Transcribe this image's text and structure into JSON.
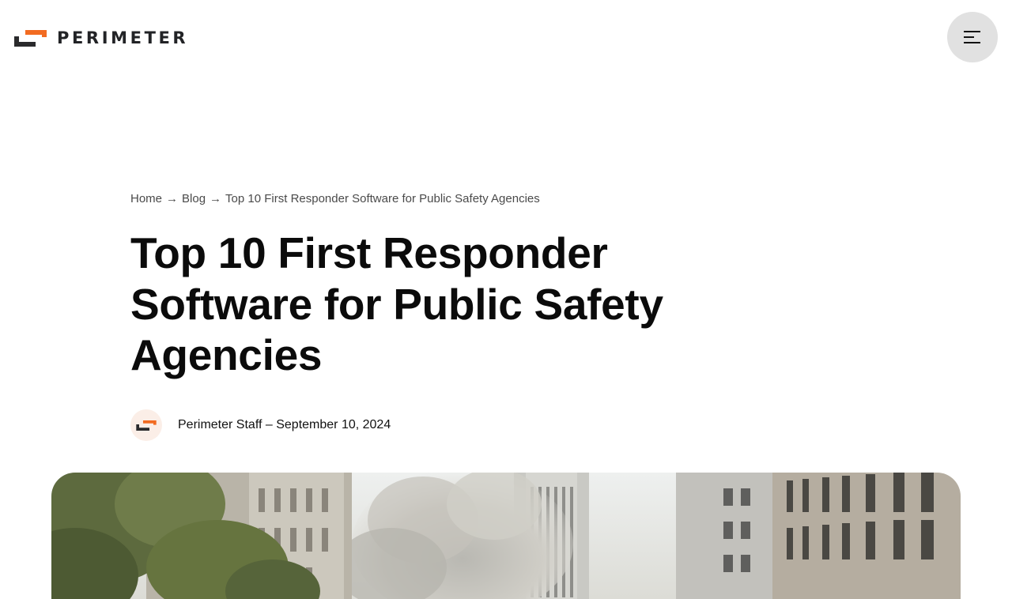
{
  "header": {
    "logo_text": "PERIMETER",
    "logo_colors": {
      "accent": "#f26b21",
      "dark": "#2a2a2c"
    },
    "menu_icon": "hamburger-menu-icon"
  },
  "breadcrumb": {
    "home": "Home",
    "blog": "Blog",
    "current": "Top 10 First Responder Software for Public Safety Agencies",
    "separator": "→"
  },
  "article": {
    "title": "Top 10 First Responder Software for Public Safety Agencies",
    "author": "Perimeter Staff",
    "date_separator": "–",
    "date": "September 10, 2024"
  },
  "colors": {
    "text": "#0b0b0b",
    "muted": "#4a4a4a",
    "menu_bg": "#e1e1e1",
    "avatar_bg": "#fbeee7"
  }
}
